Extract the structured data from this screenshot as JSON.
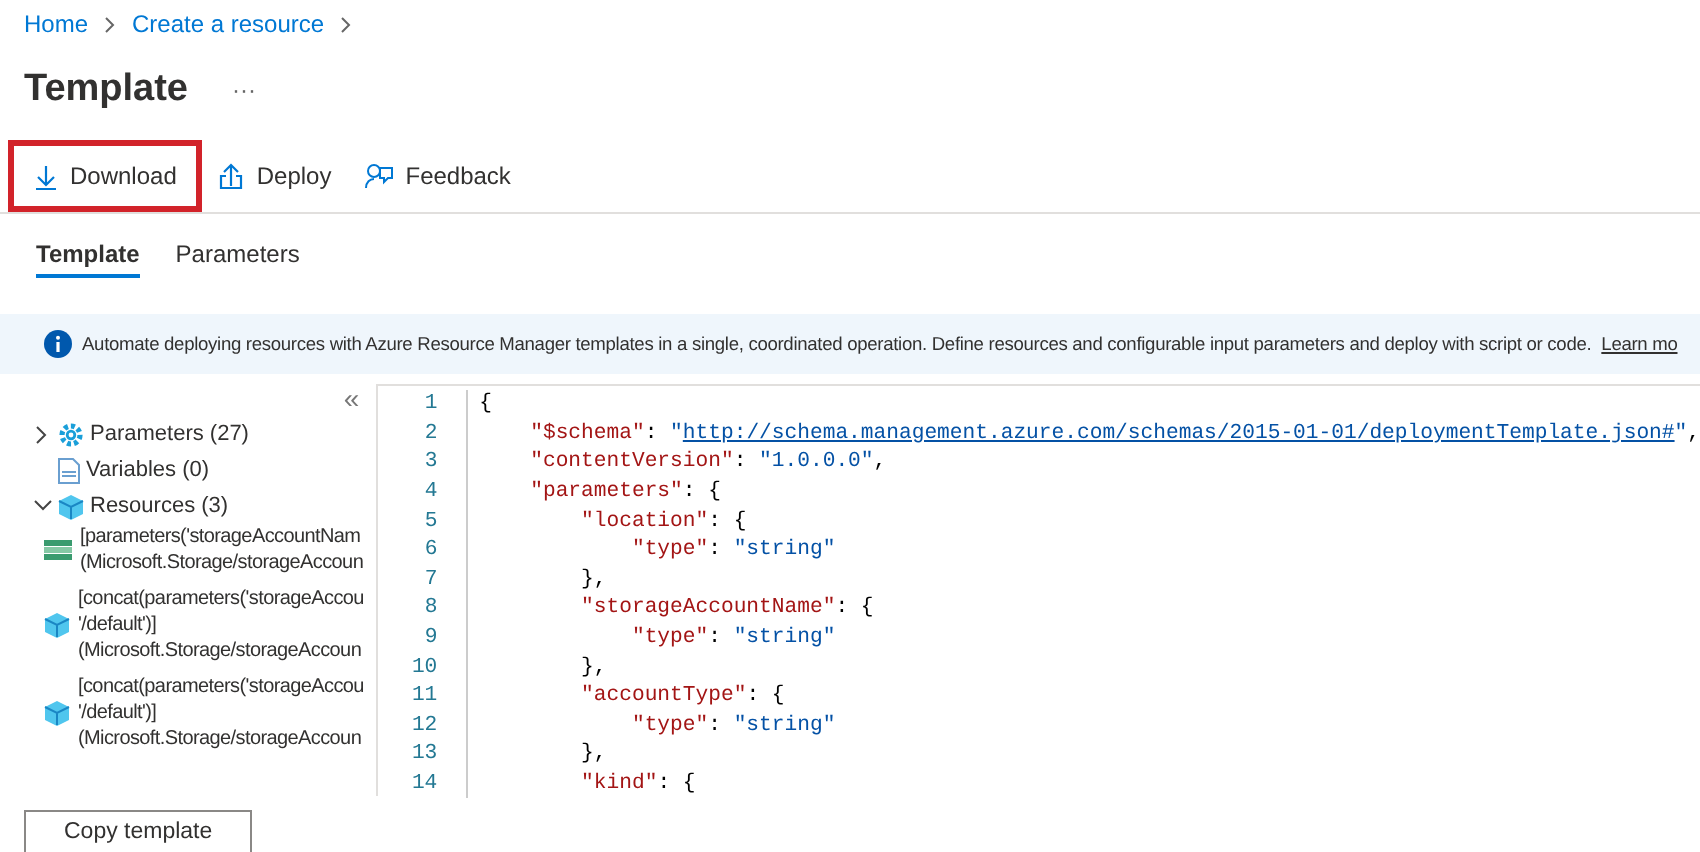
{
  "breadcrumb": [
    "Home",
    "Create a resource"
  ],
  "title": "Template",
  "more": "···",
  "toolbar": [
    {
      "kind": "download",
      "label": "Download",
      "highlighted": true
    },
    {
      "kind": "deploy",
      "label": "Deploy",
      "highlighted": false
    },
    {
      "kind": "feedback",
      "label": "Feedback",
      "highlighted": false
    }
  ],
  "tabs": [
    {
      "label": "Template",
      "selected": true
    },
    {
      "label": "Parameters",
      "selected": false
    }
  ],
  "info": {
    "text": "Automate deploying resources with Azure Resource Manager templates in a single, coordinated operation. Define resources and configurable input parameters and deploy with script or code.",
    "link": "Learn mo"
  },
  "collapse": "«",
  "tree": [
    {
      "kind": "parameters",
      "label": "Parameters (27)",
      "expanded": false
    },
    {
      "kind": "variables",
      "label": "Variables (0)"
    },
    {
      "kind": "resources",
      "label": "Resources (3)",
      "expanded": true,
      "children": [
        {
          "kind": "storage",
          "lines": [
            "[parameters('storageAccountNam",
            "(Microsoft.Storage/storageAccoun"
          ]
        },
        {
          "kind": "cube",
          "lines": [
            "[concat(parameters('storageAccou",
            "'/default')]",
            "(Microsoft.Storage/storageAccoun"
          ]
        },
        {
          "kind": "cube",
          "lines": [
            "[concat(parameters('storageAccou",
            "'/default')]",
            "(Microsoft.Storage/storageAccoun"
          ]
        }
      ]
    }
  ],
  "code": [
    {
      "number": "1",
      "segments": [
        {
          "kind": "punct",
          "text": "{"
        }
      ]
    },
    {
      "number": "2",
      "segments": [
        {
          "kind": "key",
          "text": "    \"$schema\""
        },
        {
          "kind": "punct",
          "text": ": "
        },
        {
          "kind": "string",
          "text": "\""
        },
        {
          "kind": "link",
          "text": "http://schema.management.azure.com/schemas/2015-01-01/deploymentTemplate.json#"
        },
        {
          "kind": "string",
          "text": "\""
        },
        {
          "kind": "punct",
          "text": ","
        }
      ]
    },
    {
      "number": "3",
      "segments": [
        {
          "kind": "key",
          "text": "    \"contentVersion\""
        },
        {
          "kind": "punct",
          "text": ": "
        },
        {
          "kind": "string",
          "text": "\"1.0.0.0\""
        },
        {
          "kind": "punct",
          "text": ","
        }
      ]
    },
    {
      "number": "4",
      "segments": [
        {
          "kind": "key",
          "text": "    \"parameters\""
        },
        {
          "kind": "punct",
          "text": ": {"
        }
      ]
    },
    {
      "number": "5",
      "segments": [
        {
          "kind": "key",
          "text": "        \"location\""
        },
        {
          "kind": "punct",
          "text": ": {"
        }
      ]
    },
    {
      "number": "6",
      "segments": [
        {
          "kind": "key",
          "text": "            \"type\""
        },
        {
          "kind": "punct",
          "text": ": "
        },
        {
          "kind": "string",
          "text": "\"string\""
        }
      ]
    },
    {
      "number": "7",
      "segments": [
        {
          "kind": "punct",
          "text": "        },"
        }
      ]
    },
    {
      "number": "8",
      "segments": [
        {
          "kind": "key",
          "text": "        \"storageAccountName\""
        },
        {
          "kind": "punct",
          "text": ": {"
        }
      ]
    },
    {
      "number": "9",
      "segments": [
        {
          "kind": "key",
          "text": "            \"type\""
        },
        {
          "kind": "punct",
          "text": ": "
        },
        {
          "kind": "string",
          "text": "\"string\""
        }
      ]
    },
    {
      "number": "10",
      "segments": [
        {
          "kind": "punct",
          "text": "        },"
        }
      ]
    },
    {
      "number": "11",
      "segments": [
        {
          "kind": "key",
          "text": "        \"accountType\""
        },
        {
          "kind": "punct",
          "text": ": {"
        }
      ]
    },
    {
      "number": "12",
      "segments": [
        {
          "kind": "key",
          "text": "            \"type\""
        },
        {
          "kind": "punct",
          "text": ": "
        },
        {
          "kind": "string",
          "text": "\"string\""
        }
      ]
    },
    {
      "number": "13",
      "segments": [
        {
          "kind": "punct",
          "text": "        },"
        }
      ]
    },
    {
      "number": "14",
      "segments": [
        {
          "kind": "key",
          "text": "        \"kind\""
        },
        {
          "kind": "punct",
          "text": ": {"
        }
      ]
    }
  ],
  "copy_button": "Copy template"
}
